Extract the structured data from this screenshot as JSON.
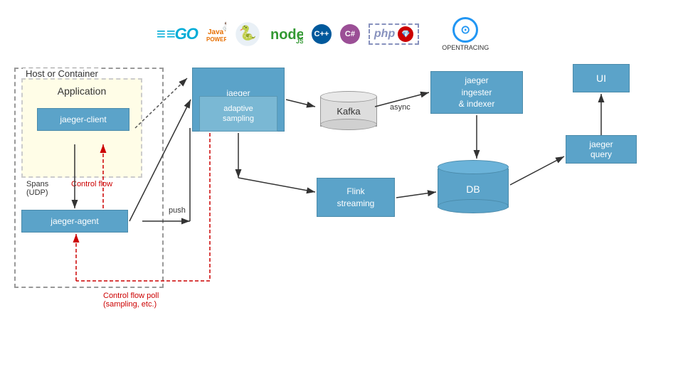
{
  "logos": [
    {
      "id": "go",
      "label": "GO",
      "type": "go"
    },
    {
      "id": "java",
      "label": "Java™\nPOWERED",
      "type": "java"
    },
    {
      "id": "python",
      "label": "python\npowered",
      "type": "python"
    },
    {
      "id": "node",
      "label": "node",
      "type": "node"
    },
    {
      "id": "cpp",
      "label": "C++",
      "type": "cpp"
    },
    {
      "id": "csharp",
      "label": "C#",
      "type": "csharp"
    },
    {
      "id": "php",
      "label": "php",
      "type": "php"
    },
    {
      "id": "ruby",
      "label": "●",
      "type": "ruby"
    },
    {
      "id": "opentracing",
      "label": "OPENTRACING",
      "type": "opentracing"
    }
  ],
  "diagram": {
    "host_label": "Host or Container",
    "app_label": "Application",
    "jaeger_client_label": "jaeger-client",
    "jaeger_agent_label": "jaeger-agent",
    "jaeger_collector_label": "jaeger\ncollector",
    "adaptive_sampling_label": "adaptive\nsampling",
    "kafka_label": "Kafka",
    "async_label": "async",
    "jaeger_ingester_label": "jaeger\ningester\n& indexer",
    "flink_label": "Flink\nstreaming",
    "db_label": "DB",
    "ui_label": "UI",
    "jaeger_query_label": "jaeger\nquery",
    "spans_label": "Spans\n(UDP)",
    "control_flow_label": "Control flow",
    "push_label": "push",
    "control_flow_poll_label": "Control flow poll\n(sampling, etc.)"
  }
}
